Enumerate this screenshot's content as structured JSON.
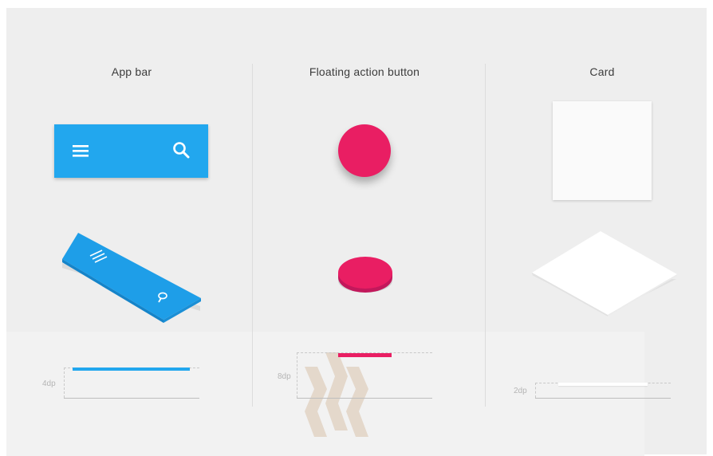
{
  "columns": [
    {
      "title": "App bar",
      "elevation_label": "4dp",
      "color": "#22a7ee"
    },
    {
      "title": "Floating action button",
      "elevation_label": "8dp",
      "color": "#e91e63"
    },
    {
      "title": "Card",
      "elevation_label": "2dp",
      "color": "#fafafa"
    }
  ],
  "icons": {
    "menu": "menu-icon",
    "search": "search-icon"
  },
  "watermark": "logo-watermark"
}
